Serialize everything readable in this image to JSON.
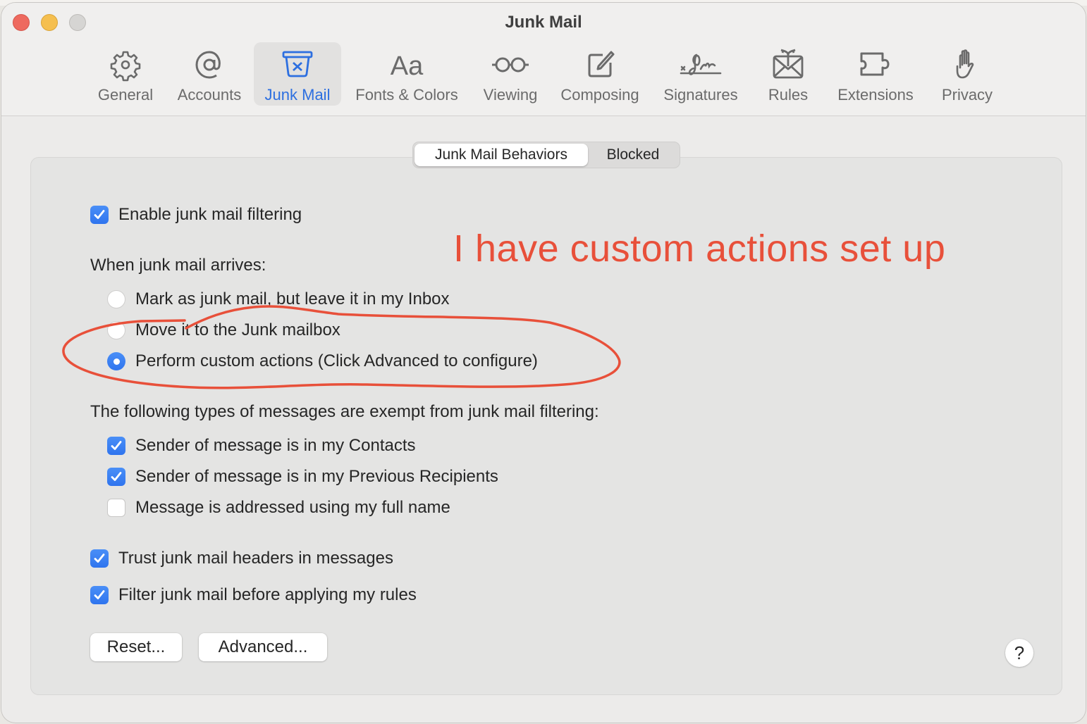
{
  "window": {
    "title": "Junk Mail"
  },
  "toolbar": {
    "tabs": [
      {
        "label": "General",
        "icon": "gear-icon",
        "active": false
      },
      {
        "label": "Accounts",
        "icon": "at-sign-icon",
        "active": false
      },
      {
        "label": "Junk Mail",
        "icon": "junk-bin-icon",
        "active": true
      },
      {
        "label": "Fonts & Colors",
        "icon": "font-aa-icon",
        "active": false
      },
      {
        "label": "Viewing",
        "icon": "glasses-icon",
        "active": false
      },
      {
        "label": "Composing",
        "icon": "compose-icon",
        "active": false
      },
      {
        "label": "Signatures",
        "icon": "signature-icon",
        "active": false
      },
      {
        "label": "Rules",
        "icon": "envelope-arrows-icon",
        "active": false
      },
      {
        "label": "Extensions",
        "icon": "puzzle-icon",
        "active": false
      },
      {
        "label": "Privacy",
        "icon": "hand-icon",
        "active": false
      }
    ]
  },
  "segmented": {
    "items": [
      {
        "label": "Junk Mail Behaviors",
        "selected": true
      },
      {
        "label": "Blocked",
        "selected": false
      }
    ]
  },
  "settings": {
    "enable_filtering": {
      "label": "Enable junk mail filtering",
      "checked": true
    },
    "arrival_heading": "When junk mail arrives:",
    "arrival_options": [
      {
        "label": "Mark as junk mail, but leave it in my Inbox",
        "selected": false
      },
      {
        "label": "Move it to the Junk mailbox",
        "selected": false
      },
      {
        "label": "Perform custom actions (Click Advanced to configure)",
        "selected": true
      }
    ],
    "exempt_heading": "The following types of messages are exempt from junk mail filtering:",
    "exempt_options": [
      {
        "label": "Sender of message is in my Contacts",
        "checked": true
      },
      {
        "label": "Sender of message is in my Previous Recipients",
        "checked": true
      },
      {
        "label": "Message is addressed using my full name",
        "checked": false
      }
    ],
    "trust_headers": {
      "label": "Trust junk mail headers in messages",
      "checked": true
    },
    "filter_before_rules": {
      "label": "Filter junk mail before applying my rules",
      "checked": true
    }
  },
  "buttons": {
    "reset": "Reset...",
    "advanced": "Advanced...",
    "help": "?"
  },
  "annotation": {
    "text": "I have custom actions set up",
    "color": "#e8503a"
  },
  "colors": {
    "accent": "#2d6fe0",
    "checkbox_on": "#3b82f6"
  }
}
